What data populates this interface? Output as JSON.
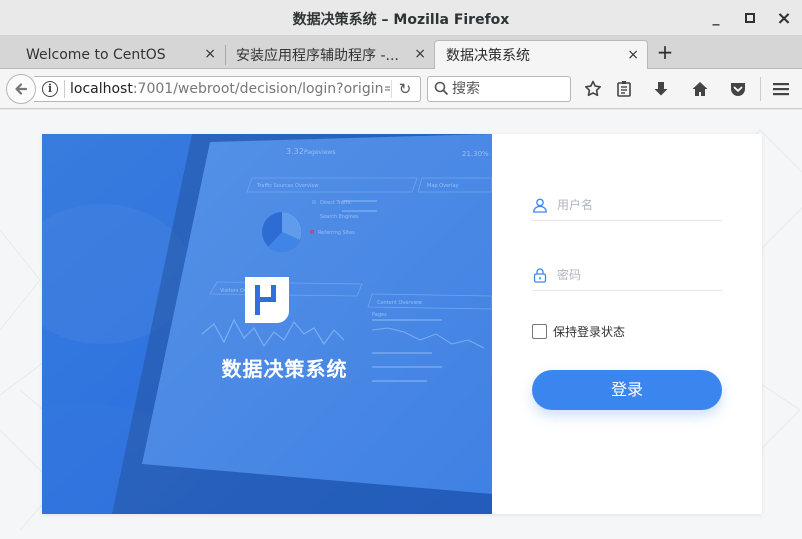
{
  "window": {
    "title": "数据决策系统 – Mozilla Firefox",
    "minimize_glyph": "_",
    "maximize_glyph": "□",
    "close_glyph": "×"
  },
  "tabs": [
    {
      "label": "Welcome to CentOS",
      "active": false
    },
    {
      "label": "安装应用程序辅助程序 -...",
      "active": false
    },
    {
      "label": "数据决策系统",
      "active": true
    }
  ],
  "tab_close_glyph": "×",
  "new_tab_glyph": "+",
  "navbar": {
    "url_host": "localhost",
    "url_rest": ":7001/webroot/decision/login?origin=",
    "search_placeholder": "搜索",
    "reload_glyph": "↻"
  },
  "icons": {
    "back": "back-arrow-icon",
    "info": "site-info-icon",
    "reload": "reload-icon",
    "search": "search-icon",
    "bookmark": "bookmark-star-icon",
    "library": "reading-list-icon",
    "downloads": "download-icon",
    "home": "home-icon",
    "pocket": "pocket-icon",
    "menu": "hamburger-menu-icon",
    "user": "user-icon",
    "lock": "lock-icon"
  },
  "hero": {
    "app_name": "数据决策系统",
    "tablet_text": {
      "visits": "3.32",
      "visits_unit": "Pageviews",
      "trend": "21.30%",
      "panel_traffic": "Traffic Sources Overview",
      "panel_map": "Map Overlay",
      "panel_visitors": "Visitors Overview",
      "panel_content": "Content Overview",
      "legend_direct": "Direct Traffic",
      "legend_search": "Search Engines",
      "legend_referring": "Referring Sites",
      "pages_header": "Pages"
    },
    "colors": {
      "overlay": "#2f78e8",
      "text": "#ffffff"
    }
  },
  "login": {
    "username_placeholder": "用户名",
    "username_value": "",
    "password_placeholder": "密码",
    "password_value": "",
    "remember_label": "保持登录状态",
    "remember_checked": false,
    "submit_label": "登录",
    "accent_color": "#3b86ee"
  }
}
